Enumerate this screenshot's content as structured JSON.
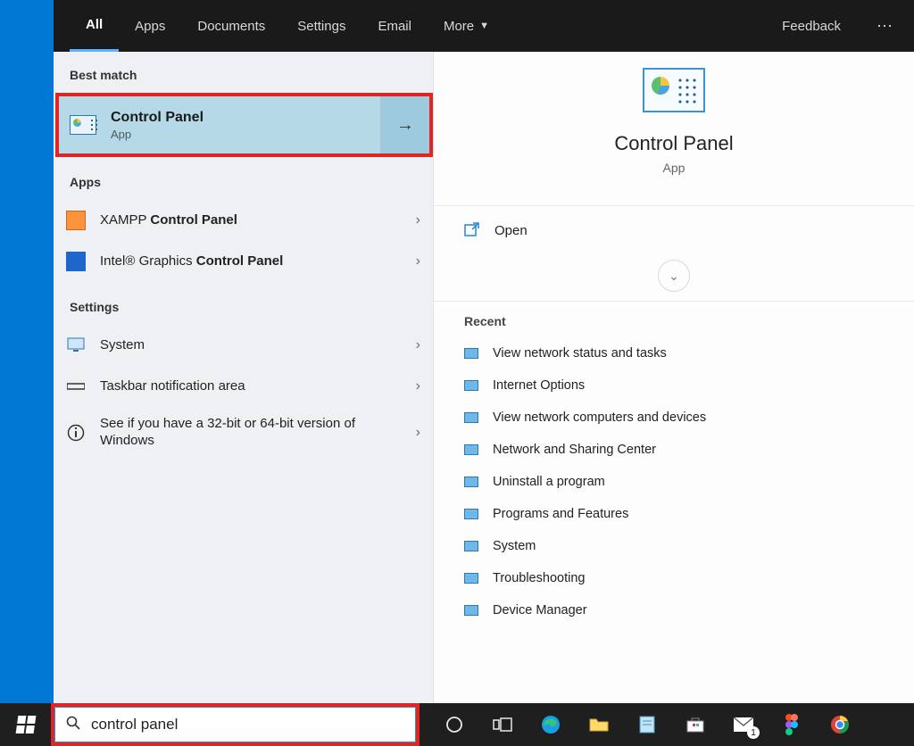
{
  "tabs": {
    "items": [
      "All",
      "Apps",
      "Documents",
      "Settings",
      "Email",
      "More"
    ],
    "active": 0,
    "feedback": "Feedback"
  },
  "left": {
    "best_label": "Best match",
    "best": {
      "title": "Control Panel",
      "subtitle": "App"
    },
    "apps_label": "Apps",
    "apps": [
      {
        "prefix": "XAMPP ",
        "match": "Control Panel",
        "icon": "xampp"
      },
      {
        "prefix": "Intel® Graphics ",
        "match": "Control Panel",
        "icon": "intel"
      }
    ],
    "settings_label": "Settings",
    "settings": [
      {
        "text": "System",
        "icon": "monitor"
      },
      {
        "text": "Taskbar notification area",
        "icon": "taskbar"
      },
      {
        "text": "See if you have a 32-bit or 64-bit version of Windows",
        "icon": "info",
        "twoline": true
      }
    ]
  },
  "right": {
    "title": "Control Panel",
    "subtitle": "App",
    "open": "Open",
    "recent_label": "Recent",
    "recent": [
      "View network status and tasks",
      "Internet Options",
      "View network computers and devices",
      "Network and Sharing Center",
      "Uninstall a program",
      "Programs and Features",
      "System",
      "Troubleshooting",
      "Device Manager"
    ]
  },
  "search": {
    "value": "control panel"
  },
  "taskbar_badge": "1"
}
